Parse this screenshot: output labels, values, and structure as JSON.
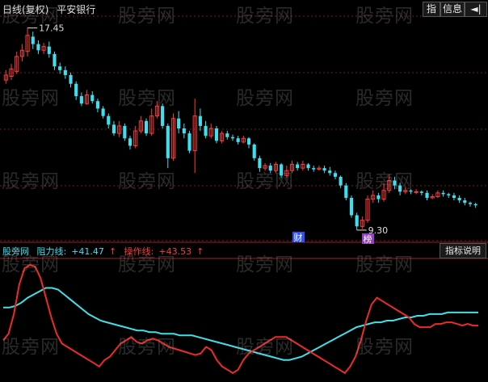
{
  "window": {
    "title_period": "日线(复权)",
    "title_stock": "平安银行"
  },
  "toolbar": {
    "indicator_label": "指",
    "info_label": "信息",
    "arrow_glyph": "◄|"
  },
  "price_chart": {
    "high_label": "17.45",
    "low_label": "9.30",
    "badges": [
      "财",
      "榜"
    ],
    "candles": [
      {
        "o": 15.35,
        "c": 15.55,
        "h": 15.75,
        "l": 15.2,
        "up": true
      },
      {
        "o": 15.5,
        "c": 15.8,
        "h": 16.0,
        "l": 15.35,
        "up": true
      },
      {
        "o": 15.7,
        "c": 16.3,
        "h": 16.5,
        "l": 15.6,
        "up": true
      },
      {
        "o": 16.3,
        "c": 16.55,
        "h": 16.8,
        "l": 16.1,
        "up": true
      },
      {
        "o": 16.5,
        "c": 17.15,
        "h": 17.45,
        "l": 16.3,
        "up": true
      },
      {
        "o": 17.1,
        "c": 16.8,
        "h": 17.3,
        "l": 16.6,
        "up": false
      },
      {
        "o": 16.8,
        "c": 16.55,
        "h": 16.95,
        "l": 16.4,
        "up": false
      },
      {
        "o": 16.55,
        "c": 16.7,
        "h": 16.85,
        "l": 16.4,
        "up": true
      },
      {
        "o": 16.7,
        "c": 16.4,
        "h": 16.9,
        "l": 16.25,
        "up": false
      },
      {
        "o": 16.4,
        "c": 15.9,
        "h": 16.5,
        "l": 15.75,
        "up": false
      },
      {
        "o": 15.9,
        "c": 15.75,
        "h": 16.05,
        "l": 15.6,
        "up": false
      },
      {
        "o": 15.75,
        "c": 15.55,
        "h": 15.9,
        "l": 15.4,
        "up": false
      },
      {
        "o": 15.55,
        "c": 15.2,
        "h": 15.65,
        "l": 15.05,
        "up": false
      },
      {
        "o": 15.2,
        "c": 14.7,
        "h": 15.3,
        "l": 14.55,
        "up": false
      },
      {
        "o": 14.7,
        "c": 14.4,
        "h": 14.85,
        "l": 14.3,
        "up": false
      },
      {
        "o": 14.4,
        "c": 14.75,
        "h": 14.95,
        "l": 14.35,
        "up": true
      },
      {
        "o": 14.75,
        "c": 14.5,
        "h": 14.9,
        "l": 14.4,
        "up": false
      },
      {
        "o": 14.5,
        "c": 14.2,
        "h": 14.6,
        "l": 14.05,
        "up": false
      },
      {
        "o": 14.2,
        "c": 13.9,
        "h": 14.3,
        "l": 13.8,
        "up": false
      },
      {
        "o": 13.9,
        "c": 13.55,
        "h": 14.0,
        "l": 13.4,
        "up": false
      },
      {
        "o": 13.55,
        "c": 13.2,
        "h": 13.7,
        "l": 13.1,
        "up": false
      },
      {
        "o": 13.2,
        "c": 13.5,
        "h": 13.7,
        "l": 13.05,
        "up": true
      },
      {
        "o": 13.5,
        "c": 13.0,
        "h": 13.6,
        "l": 12.9,
        "up": false
      },
      {
        "o": 13.0,
        "c": 12.7,
        "h": 13.1,
        "l": 12.55,
        "up": false
      },
      {
        "o": 12.7,
        "c": 13.3,
        "h": 13.5,
        "l": 12.6,
        "up": true
      },
      {
        "o": 13.3,
        "c": 13.7,
        "h": 13.9,
        "l": 13.2,
        "up": true
      },
      {
        "o": 13.7,
        "c": 13.2,
        "h": 13.8,
        "l": 13.1,
        "up": false
      },
      {
        "o": 13.2,
        "c": 13.9,
        "h": 14.2,
        "l": 13.1,
        "up": true
      },
      {
        "o": 13.9,
        "c": 14.3,
        "h": 14.5,
        "l": 13.8,
        "up": true
      },
      {
        "o": 14.3,
        "c": 13.5,
        "h": 14.4,
        "l": 13.4,
        "up": false
      },
      {
        "o": 13.5,
        "c": 12.2,
        "h": 13.6,
        "l": 11.8,
        "up": false
      },
      {
        "o": 12.2,
        "c": 13.8,
        "h": 14.0,
        "l": 12.1,
        "up": true
      },
      {
        "o": 13.8,
        "c": 13.4,
        "h": 14.1,
        "l": 13.2,
        "up": false
      },
      {
        "o": 13.4,
        "c": 13.2,
        "h": 13.6,
        "l": 13.0,
        "up": false
      },
      {
        "o": 13.2,
        "c": 12.5,
        "h": 13.3,
        "l": 12.4,
        "up": false
      },
      {
        "o": 12.5,
        "c": 13.9,
        "h": 14.6,
        "l": 11.6,
        "up": true
      },
      {
        "o": 13.9,
        "c": 13.5,
        "h": 14.2,
        "l": 13.3,
        "up": false
      },
      {
        "o": 13.5,
        "c": 13.1,
        "h": 13.7,
        "l": 13.0,
        "up": false
      },
      {
        "o": 13.1,
        "c": 13.4,
        "h": 13.6,
        "l": 13.0,
        "up": true
      },
      {
        "o": 13.4,
        "c": 12.9,
        "h": 13.5,
        "l": 12.8,
        "up": false
      },
      {
        "o": 12.9,
        "c": 13.2,
        "h": 13.3,
        "l": 12.8,
        "up": true
      },
      {
        "o": 13.2,
        "c": 13.05,
        "h": 13.3,
        "l": 12.95,
        "up": false
      },
      {
        "o": 13.05,
        "c": 13.0,
        "h": 13.15,
        "l": 12.9,
        "up": false
      },
      {
        "o": 13.0,
        "c": 12.85,
        "h": 13.1,
        "l": 12.75,
        "up": false
      },
      {
        "o": 12.85,
        "c": 13.0,
        "h": 13.1,
        "l": 12.8,
        "up": true
      },
      {
        "o": 13.0,
        "c": 12.75,
        "h": 13.05,
        "l": 12.6,
        "up": false
      },
      {
        "o": 12.75,
        "c": 12.2,
        "h": 12.8,
        "l": 12.1,
        "up": false
      },
      {
        "o": 12.2,
        "c": 11.8,
        "h": 12.3,
        "l": 11.65,
        "up": false
      },
      {
        "o": 11.8,
        "c": 11.9,
        "h": 12.0,
        "l": 11.7,
        "up": true
      },
      {
        "o": 11.9,
        "c": 11.7,
        "h": 12.0,
        "l": 11.6,
        "up": false
      },
      {
        "o": 11.7,
        "c": 11.95,
        "h": 12.05,
        "l": 11.6,
        "up": true
      },
      {
        "o": 11.95,
        "c": 11.5,
        "h": 12.0,
        "l": 11.4,
        "up": false
      },
      {
        "o": 11.5,
        "c": 11.7,
        "h": 11.9,
        "l": 11.4,
        "up": true
      },
      {
        "o": 11.7,
        "c": 11.95,
        "h": 12.1,
        "l": 11.6,
        "up": true
      },
      {
        "o": 11.95,
        "c": 11.8,
        "h": 12.05,
        "l": 11.7,
        "up": false
      },
      {
        "o": 11.8,
        "c": 11.95,
        "h": 12.1,
        "l": 11.7,
        "up": true
      },
      {
        "o": 11.95,
        "c": 11.8,
        "h": 12.0,
        "l": 11.7,
        "up": false
      },
      {
        "o": 11.8,
        "c": 11.75,
        "h": 11.9,
        "l": 11.65,
        "up": false
      },
      {
        "o": 11.75,
        "c": 11.8,
        "h": 11.9,
        "l": 11.7,
        "up": true
      },
      {
        "o": 11.8,
        "c": 11.7,
        "h": 11.9,
        "l": 11.6,
        "up": false
      },
      {
        "o": 11.7,
        "c": 11.6,
        "h": 11.85,
        "l": 11.5,
        "up": false
      },
      {
        "o": 11.6,
        "c": 11.45,
        "h": 11.7,
        "l": 11.35,
        "up": false
      },
      {
        "o": 11.45,
        "c": 11.1,
        "h": 11.5,
        "l": 11.0,
        "up": false
      },
      {
        "o": 11.1,
        "c": 10.6,
        "h": 11.2,
        "l": 10.5,
        "up": false
      },
      {
        "o": 10.6,
        "c": 9.9,
        "h": 10.7,
        "l": 9.8,
        "up": false
      },
      {
        "o": 9.9,
        "c": 9.45,
        "h": 10.0,
        "l": 9.3,
        "up": false
      },
      {
        "o": 9.45,
        "c": 9.7,
        "h": 9.85,
        "l": 9.35,
        "up": true
      },
      {
        "o": 9.7,
        "c": 10.55,
        "h": 10.7,
        "l": 9.6,
        "up": true
      },
      {
        "o": 10.55,
        "c": 10.7,
        "h": 10.9,
        "l": 10.4,
        "up": true
      },
      {
        "o": 10.7,
        "c": 10.55,
        "h": 10.8,
        "l": 10.4,
        "up": false
      },
      {
        "o": 10.55,
        "c": 10.9,
        "h": 11.2,
        "l": 10.45,
        "up": true
      },
      {
        "o": 10.9,
        "c": 11.3,
        "h": 11.55,
        "l": 10.8,
        "up": true
      },
      {
        "o": 11.3,
        "c": 11.1,
        "h": 11.45,
        "l": 10.95,
        "up": false
      },
      {
        "o": 11.1,
        "c": 10.85,
        "h": 11.2,
        "l": 10.7,
        "up": false
      },
      {
        "o": 10.85,
        "c": 10.9,
        "h": 11.05,
        "l": 10.75,
        "up": true
      },
      {
        "o": 10.9,
        "c": 10.85,
        "h": 10.95,
        "l": 10.75,
        "up": false
      },
      {
        "o": 10.85,
        "c": 10.85,
        "h": 10.95,
        "l": 10.75,
        "up": true
      },
      {
        "o": 10.85,
        "c": 10.8,
        "h": 10.9,
        "l": 10.7,
        "up": false
      },
      {
        "o": 10.8,
        "c": 10.6,
        "h": 10.9,
        "l": 10.5,
        "up": false
      },
      {
        "o": 10.6,
        "c": 10.65,
        "h": 10.75,
        "l": 10.55,
        "up": true
      },
      {
        "o": 10.65,
        "c": 10.8,
        "h": 10.9,
        "l": 10.6,
        "up": true
      },
      {
        "o": 10.8,
        "c": 10.75,
        "h": 10.9,
        "l": 10.65,
        "up": false
      },
      {
        "o": 10.75,
        "c": 10.7,
        "h": 10.8,
        "l": 10.6,
        "up": false
      },
      {
        "o": 10.7,
        "c": 10.6,
        "h": 10.8,
        "l": 10.5,
        "up": false
      },
      {
        "o": 10.6,
        "c": 10.5,
        "h": 10.7,
        "l": 10.4,
        "up": false
      },
      {
        "o": 10.5,
        "c": 10.4,
        "h": 10.6,
        "l": 10.3,
        "up": false
      },
      {
        "o": 10.4,
        "c": 10.35,
        "h": 10.45,
        "l": 10.25,
        "up": false
      },
      {
        "o": 10.35,
        "c": 10.3,
        "h": 10.4,
        "l": 10.2,
        "up": false
      }
    ]
  },
  "indicator": {
    "name": "股旁网",
    "resistance_label": "阻力线:",
    "resistance_value": "+41.47",
    "operation_label": "操作线:",
    "operation_value": "+43.53",
    "up_arrow": "↑",
    "explain_button": "指标说明",
    "cyan_line": [
      44,
      44,
      45,
      47,
      50,
      52,
      54,
      56,
      56,
      55,
      52,
      49,
      46,
      43,
      40,
      38,
      36,
      35,
      34,
      33,
      32,
      31,
      30,
      30,
      29,
      29,
      28,
      28,
      28,
      27,
      27,
      27,
      26,
      25,
      24,
      23,
      22,
      21,
      20,
      19,
      18,
      17,
      16,
      15,
      14,
      13,
      12,
      12,
      13,
      14,
      16,
      18,
      20,
      22,
      24,
      26,
      28,
      30,
      32,
      33,
      34,
      35,
      35,
      36,
      36,
      37,
      38,
      38,
      39,
      39,
      40,
      40,
      40,
      41,
      41,
      41,
      41,
      41,
      41
    ],
    "red_line": [
      24,
      28,
      40,
      58,
      68,
      70,
      69,
      62,
      50,
      38,
      28,
      22,
      20,
      18,
      16,
      14,
      12,
      10,
      8,
      12,
      14,
      18,
      22,
      24,
      26,
      23,
      22,
      24,
      25,
      24,
      22,
      20,
      19,
      18,
      17,
      16,
      15,
      16,
      20,
      18,
      12,
      8,
      6,
      4,
      6,
      12,
      16,
      18,
      20,
      22,
      24,
      26,
      26,
      26,
      24,
      22,
      20,
      18,
      16,
      14,
      12,
      10,
      8,
      6,
      4,
      8,
      14,
      24,
      36,
      46,
      50,
      48,
      46,
      44,
      42,
      40,
      38,
      34,
      32,
      32,
      32,
      34,
      34,
      35,
      35,
      34,
      33,
      34,
      33,
      33
    ]
  },
  "watermark": "股旁网",
  "colors": {
    "up": "#ff3b3b",
    "down": "#3ee0f0",
    "grid": "#7a1a1a",
    "cyan_line": "#40e0e8",
    "red_line": "#ee2a2a",
    "label_red": "#ff5a5a",
    "label_green": "#50ff80"
  }
}
